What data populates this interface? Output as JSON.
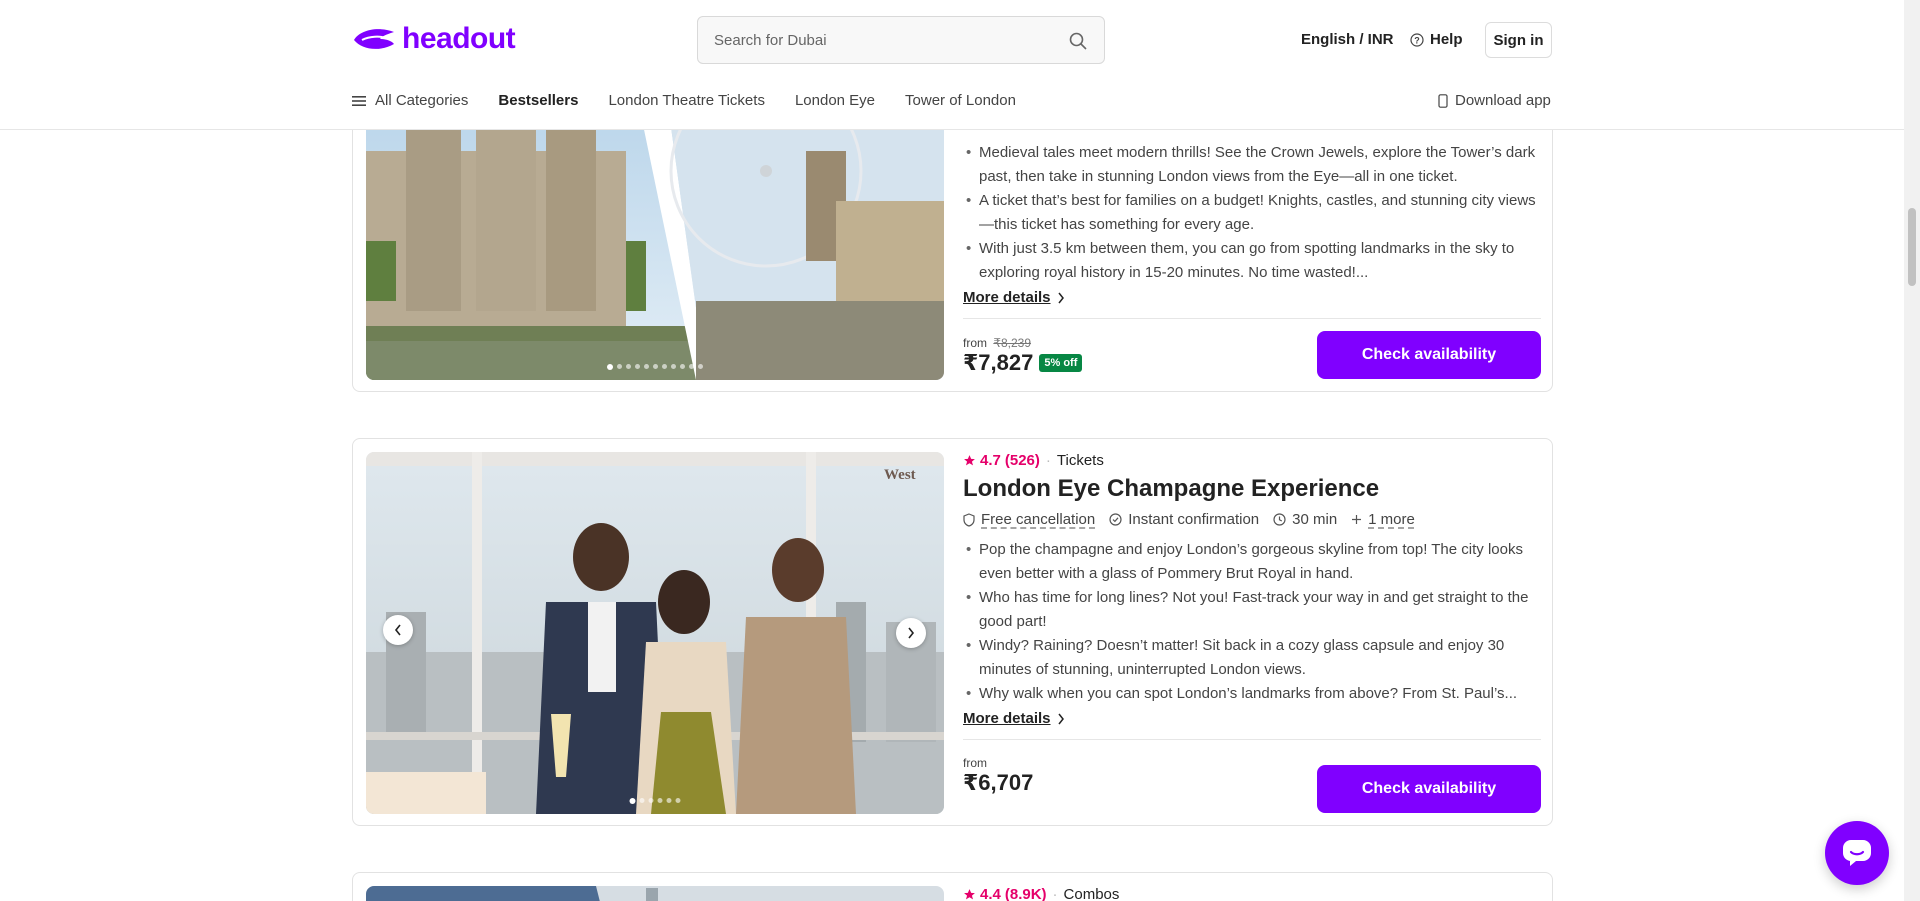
{
  "header": {
    "logo": "headout",
    "search_placeholder": "Search for Dubai",
    "language_currency": "English / INR",
    "help": "Help",
    "sign_in": "Sign in"
  },
  "nav": {
    "all_categories": "All Categories",
    "items": [
      "Bestsellers",
      "London Theatre Tickets",
      "London Eye",
      "Tower of London"
    ],
    "download_app": "Download app"
  },
  "cards": [
    {
      "bullets": [
        "Medieval tales meet modern thrills! See the Crown Jewels, explore the Tower’s dark past, then take in stunning London views from the Eye—all in one ticket.",
        "A ticket that’s best for families on a budget! Knights, castles, and stunning city views—this ticket has something for every age.",
        "With just 3.5 km between them, you can go from spotting landmarks in the sky to exploring royal history in 15-20 minutes. No time wasted!..."
      ],
      "more_details": "More details",
      "from": "from",
      "original_price": "₹8,239",
      "price": "₹7,827",
      "discount": "5% off",
      "cta": "Check availability"
    },
    {
      "rating": "4.7",
      "rating_count": "(526)",
      "category": "Tickets",
      "title": "London Eye Champagne Experience",
      "features": [
        "Free cancellation",
        "Instant confirmation",
        "30 min",
        "1 more"
      ],
      "image_label": "West",
      "bullets": [
        "Pop the champagne and enjoy London’s gorgeous skyline from top! The city looks even better with a glass of Pommery Brut Royal in hand.",
        "Who has time for long lines? Not you!   Fast-track your way in and get straight to the good part!",
        "Windy? Raining? Doesn’t matter! Sit back in a cozy glass capsule and enjoy 30 minutes of stunning, uninterrupted London views.",
        "Why walk when you can spot London’s landmarks from above? From St. Paul’s..."
      ],
      "more_details": "More details",
      "from": "from",
      "price": "₹6,707",
      "cta": "Check availability"
    },
    {
      "rating": "4.4",
      "rating_count": "(8.9K)",
      "category": "Combos"
    }
  ],
  "colors": {
    "brand": "#8000ff",
    "rating": "#e5006a",
    "discount": "#078744"
  }
}
